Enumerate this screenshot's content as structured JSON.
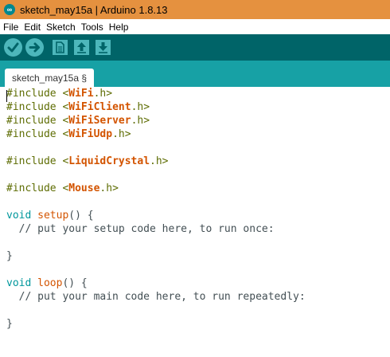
{
  "window": {
    "title": "sketch_may15a | Arduino 1.8.13",
    "logo_glyph": "∞"
  },
  "menu": [
    "File",
    "Edit",
    "Sketch",
    "Tools",
    "Help"
  ],
  "toolbar": {
    "buttons": [
      {
        "icon": "verify-check-icon",
        "glyph": "✓"
      },
      {
        "icon": "upload-arrow-icon",
        "glyph": "➜"
      },
      {
        "icon": "new-document-icon",
        "glyph": ""
      },
      {
        "icon": "open-arrow-up-icon",
        "glyph": ""
      },
      {
        "icon": "save-arrow-down-icon",
        "glyph": ""
      }
    ]
  },
  "tab": {
    "label": "sketch_may15a §"
  },
  "code": {
    "l1": {
      "a": "#include <",
      "b": "WiFi",
      "c": ".h>"
    },
    "l2": {
      "a": "#include <",
      "b": "WiFiClient",
      "c": ".h>"
    },
    "l3": {
      "a": "#include <",
      "b": "WiFiServer",
      "c": ".h>"
    },
    "l4": {
      "a": "#include <",
      "b": "WiFiUdp",
      "c": ".h>"
    },
    "l5": {
      "a": "#include <",
      "b": "LiquidCrystal",
      "c": ".h>"
    },
    "l6": {
      "a": "#include <",
      "b": "Mouse",
      "c": ".h>"
    },
    "l7": {
      "kw": "void",
      "fn": "setup",
      "rest": "() {"
    },
    "l8": {
      "comment": "  // put your setup code here, to run once:"
    },
    "l9": {
      "text": "}"
    },
    "l10": {
      "kw": "void",
      "fn": "loop",
      "rest": "() {"
    },
    "l11": {
      "comment": "  // put your main code here, to run repeatedly:"
    },
    "l12": {
      "text": "}"
    }
  },
  "colors": {
    "title_bar": "#e5913f",
    "toolbar": "#006468",
    "tab_bar": "#17a1a5",
    "button": "#4db7bb"
  }
}
